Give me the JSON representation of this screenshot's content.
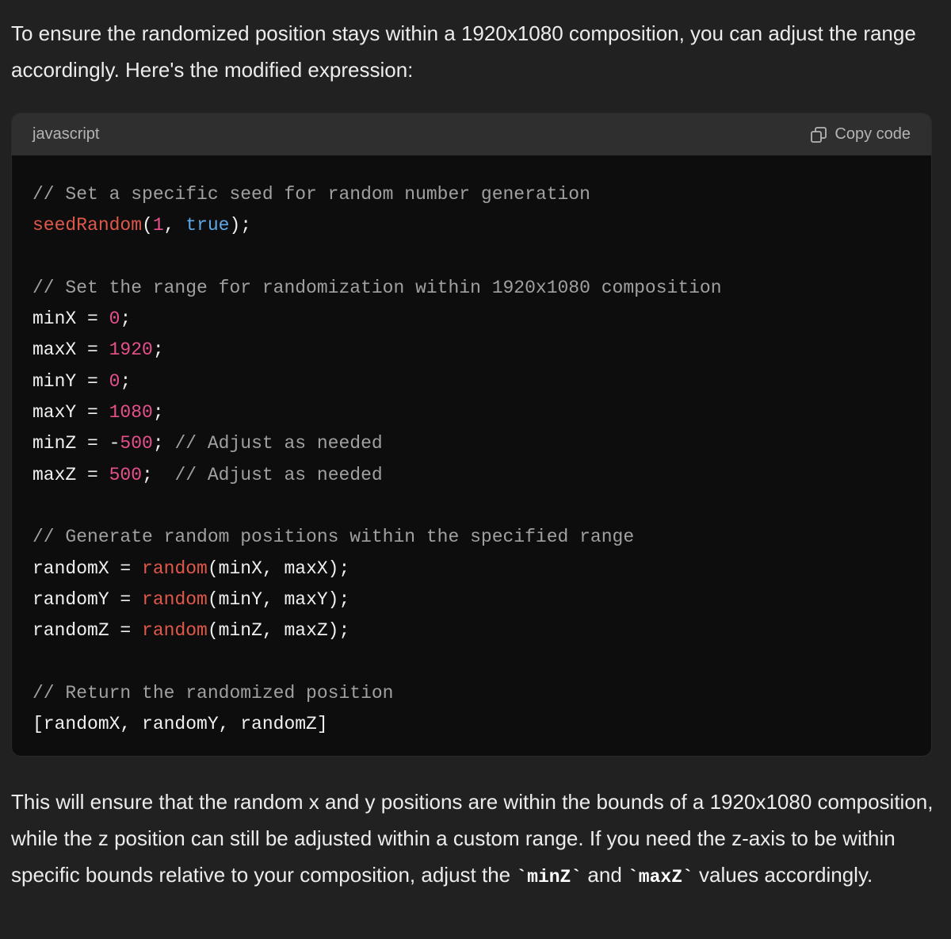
{
  "message": {
    "intro": "To ensure the randomized position stays within a 1920x1080 composition, you can adjust the range accordingly. Here's the modified expression:",
    "outro_parts": [
      "This will ensure that the random x and y positions are within the bounds of a 1920x1080 composition, while the z position can still be adjusted within a custom range. If you need the z-axis to be within specific bounds relative to your composition, adjust the ",
      "`minZ`",
      " and ",
      "`maxZ`",
      " values accordingly."
    ]
  },
  "code_block": {
    "language": "javascript",
    "copy_label": "Copy code",
    "copy_icon": "copy-icon",
    "lines": [
      [
        {
          "t": "// Set a specific seed for random number generation",
          "c": "comment"
        }
      ],
      [
        {
          "t": "seedRandom",
          "c": "fn"
        },
        {
          "t": "(",
          "c": "plain"
        },
        {
          "t": "1",
          "c": "num"
        },
        {
          "t": ", ",
          "c": "plain"
        },
        {
          "t": "true",
          "c": "bool"
        },
        {
          "t": ");",
          "c": "plain"
        }
      ],
      [],
      [
        {
          "t": "// Set the range for randomization within 1920x1080 composition",
          "c": "comment"
        }
      ],
      [
        {
          "t": "minX = ",
          "c": "plain"
        },
        {
          "t": "0",
          "c": "num"
        },
        {
          "t": ";",
          "c": "plain"
        }
      ],
      [
        {
          "t": "maxX = ",
          "c": "plain"
        },
        {
          "t": "1920",
          "c": "num"
        },
        {
          "t": ";",
          "c": "plain"
        }
      ],
      [
        {
          "t": "minY = ",
          "c": "plain"
        },
        {
          "t": "0",
          "c": "num"
        },
        {
          "t": ";",
          "c": "plain"
        }
      ],
      [
        {
          "t": "maxY = ",
          "c": "plain"
        },
        {
          "t": "1080",
          "c": "num"
        },
        {
          "t": ";",
          "c": "plain"
        }
      ],
      [
        {
          "t": "minZ = -",
          "c": "plain"
        },
        {
          "t": "500",
          "c": "num"
        },
        {
          "t": "; ",
          "c": "plain"
        },
        {
          "t": "// Adjust as needed",
          "c": "comment"
        }
      ],
      [
        {
          "t": "maxZ = ",
          "c": "plain"
        },
        {
          "t": "500",
          "c": "num"
        },
        {
          "t": ";  ",
          "c": "plain"
        },
        {
          "t": "// Adjust as needed",
          "c": "comment"
        }
      ],
      [],
      [
        {
          "t": "// Generate random positions within the specified range",
          "c": "comment"
        }
      ],
      [
        {
          "t": "randomX = ",
          "c": "plain"
        },
        {
          "t": "random",
          "c": "fn"
        },
        {
          "t": "(minX, maxX);",
          "c": "plain"
        }
      ],
      [
        {
          "t": "randomY = ",
          "c": "plain"
        },
        {
          "t": "random",
          "c": "fn"
        },
        {
          "t": "(minY, maxY);",
          "c": "plain"
        }
      ],
      [
        {
          "t": "randomZ = ",
          "c": "plain"
        },
        {
          "t": "random",
          "c": "fn"
        },
        {
          "t": "(minZ, maxZ);",
          "c": "plain"
        }
      ],
      [],
      [
        {
          "t": "// Return the randomized position",
          "c": "comment"
        }
      ],
      [
        {
          "t": "[randomX, randomY, randomZ]",
          "c": "plain"
        }
      ]
    ]
  },
  "colors": {
    "background": "#212121",
    "code_background": "#0d0d0d",
    "code_header": "#2f2f2f",
    "comment": "#a0a0a0",
    "function": "#e0584a",
    "number": "#e8508c",
    "boolean": "#5fa8e8"
  }
}
